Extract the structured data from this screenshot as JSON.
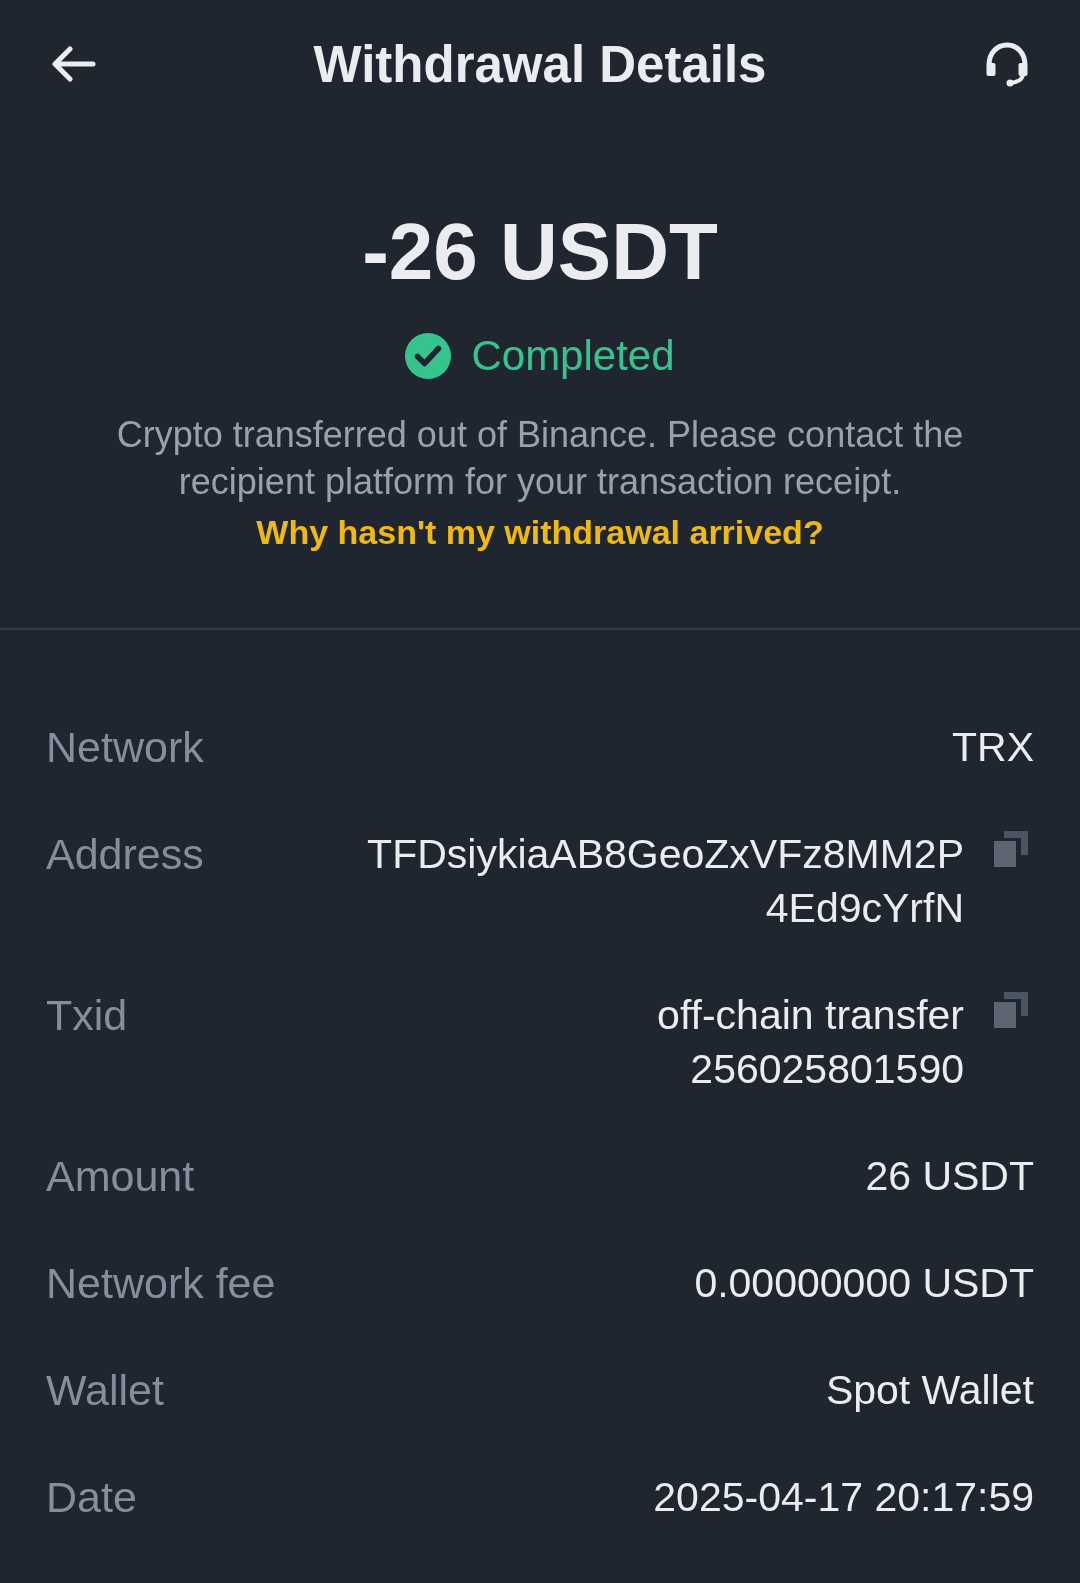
{
  "header": {
    "title": "Withdrawal Details"
  },
  "summary": {
    "amount": "-26 USDT",
    "status": {
      "label": "Completed",
      "kind": "completed"
    },
    "description": "Crypto transferred out of Binance. Please contact the recipient platform for your transaction receipt.",
    "help_link": "Why hasn't my withdrawal arrived?"
  },
  "details": [
    {
      "label": "Network",
      "value_lines": [
        "TRX"
      ],
      "copyable": false
    },
    {
      "label": "Address",
      "value_lines": [
        "TFDsiykiaAB8GeoZxVFz8MM2P",
        "4Ed9cYrfN"
      ],
      "copyable": true
    },
    {
      "label": "Txid",
      "value_lines": [
        "off-chain transfer",
        "256025801590"
      ],
      "copyable": true
    },
    {
      "label": "Amount",
      "value_lines": [
        "26 USDT"
      ],
      "copyable": false
    },
    {
      "label": "Network fee",
      "value_lines": [
        "0.00000000 USDT"
      ],
      "copyable": false
    },
    {
      "label": "Wallet",
      "value_lines": [
        "Spot Wallet"
      ],
      "copyable": false
    },
    {
      "label": "Date",
      "value_lines": [
        "2025-04-17 20:17:59"
      ],
      "copyable": false
    }
  ]
}
